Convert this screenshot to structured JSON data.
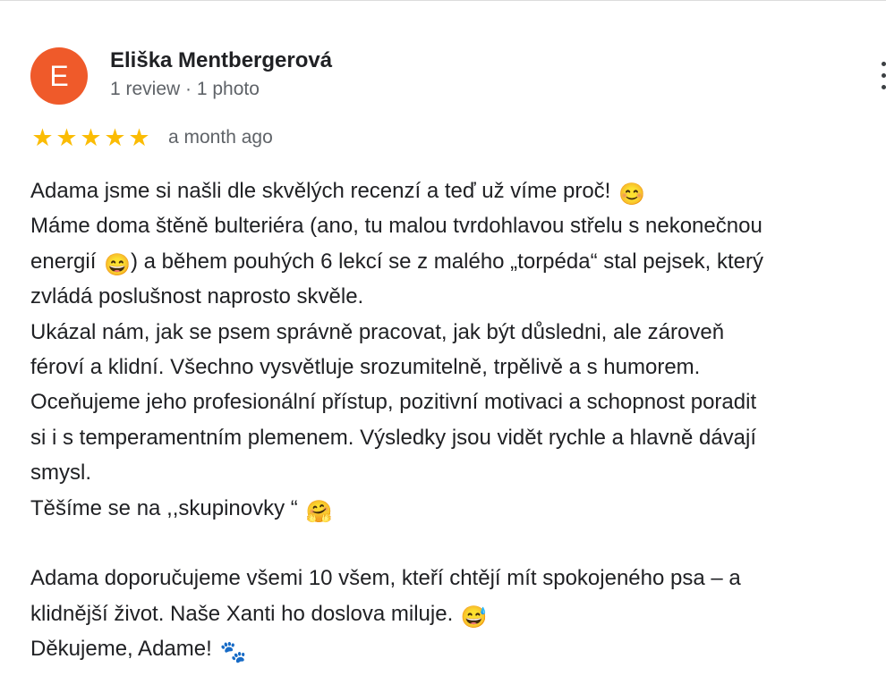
{
  "author": {
    "initial": "E",
    "name": "Eliška Mentbergerová",
    "meta": "1 review · 1 photo",
    "avatar_color": "#ef5a2a"
  },
  "more_menu_icon": "more-vertical-icon",
  "rating": {
    "stars": 5,
    "max_stars": 5,
    "star_color": "#fbbc04",
    "date": "a month ago"
  },
  "review": {
    "lines": [
      "Adama jsme si našli dle skvělých recenzí a teď už víme proč!",
      "Máme doma štěně bulteriéra (ano, tu malou tvrdohlavou střelu s nekonečnou",
      "energií",
      ") a během pouhých 6 lekcí se z malého „torpéda“ stal pejsek, který",
      "zvládá poslušnost naprosto skvěle.",
      "Ukázal nám, jak se psem správně pracovat, jak být důsledni, ale zároveň",
      "féroví a klidní. Všechno vysvětluje srozumitelně, trpělivě a s humorem.",
      "Oceňujeme jeho profesionální přístup, pozitivní motivaci a schopnost poradit",
      "si i s temperamentním plemenem. Výsledky jsou vidět rychle a hlavně dávají",
      "smysl.",
      "Těšíme se na ,,skupinovky “",
      "Adama doporučujeme všemi 10 všem, kteří chtějí mít spokojeného psa – a",
      "klidnější život. Naše Xanti ho doslova miluje.",
      "Děkujeme, Adame!"
    ],
    "emojis": {
      "smile": "😊",
      "grin": "😄",
      "hug": "🤗",
      "sweat_smile": "😅",
      "paw_prints": "🐾"
    }
  }
}
